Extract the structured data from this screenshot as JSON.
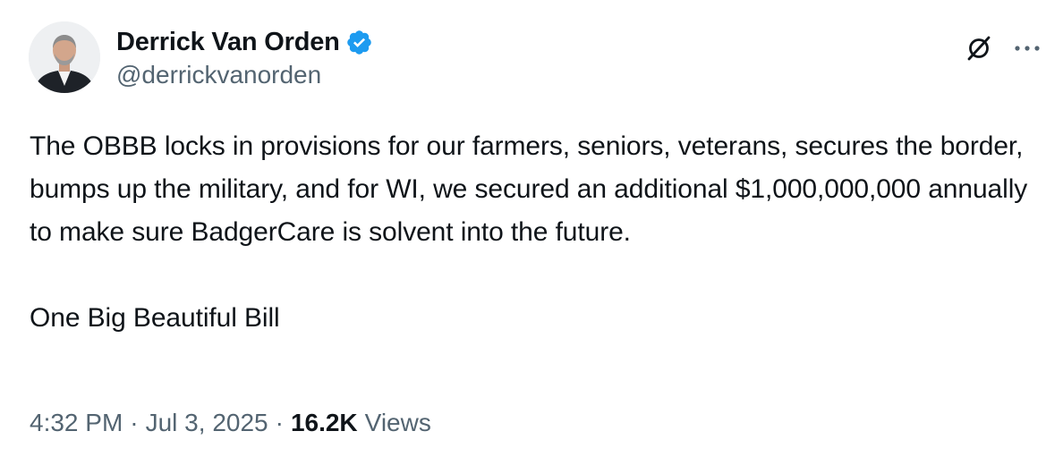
{
  "author": {
    "display_name": "Derrick Van Orden",
    "handle": "@derrickvanorden",
    "verified": true,
    "verified_color": "#1d9bf0",
    "avatar": "profile-photo"
  },
  "actions": {
    "grok_icon": "grok-icon",
    "more_icon": "more-options-icon"
  },
  "tweet": {
    "text": "The OBBB locks in provisions for our farmers, seniors, veterans, secures the border, bumps up the military, and for WI, we secured an additional $1,000,000,000 annually to make sure BadgerCare is solvent into the future.\n\nOne Big Beautiful Bill"
  },
  "meta": {
    "time": "4:32 PM",
    "separator": "·",
    "date": "Jul 3, 2025",
    "views_count": "16.2K",
    "views_label": "Views"
  }
}
